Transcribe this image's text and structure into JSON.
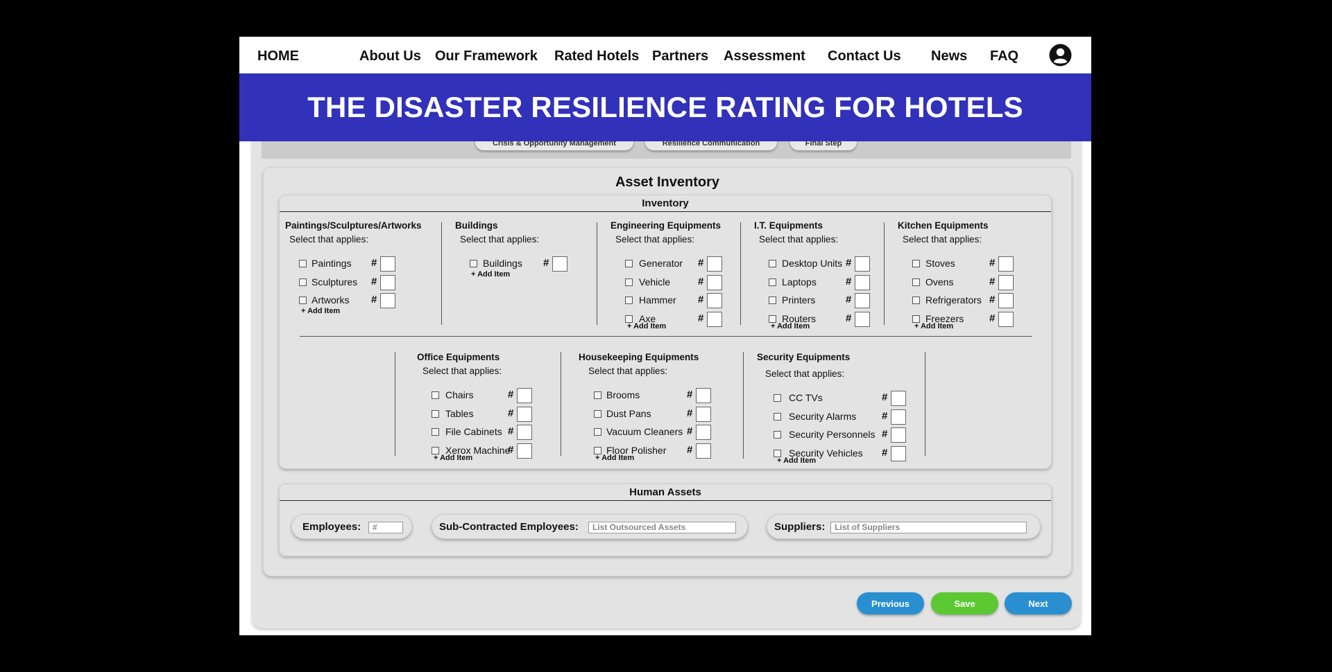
{
  "nav": {
    "home": "HOME",
    "items": [
      "About Us",
      "Our Framework",
      "Rated Hotels",
      "Partners",
      "Assessment",
      "Contact Us",
      "News",
      "FAQ"
    ]
  },
  "banner": {
    "title": "THE DISASTER RESILIENCE RATING FOR HOTELS"
  },
  "steps": [
    "Crisis & Opportunity Management",
    "Resilience Communication",
    "Final Step"
  ],
  "asset_inventory": {
    "title": "Asset Inventory",
    "inventory": {
      "title": "Inventory",
      "hash": "#",
      "add_item": "+ Add Item",
      "select_prompt": "Select that applies:",
      "groups": [
        {
          "title": "Paintings/Sculptures/Artworks",
          "items": [
            "Paintings",
            "Sculptures",
            "Artworks"
          ]
        },
        {
          "title": "Buildings",
          "items": [
            "Buildings"
          ]
        },
        {
          "title": "Engineering Equipments",
          "items": [
            "Generator",
            "Vehicle",
            "Hammer",
            "Axe"
          ]
        },
        {
          "title": "I.T. Equipments",
          "items": [
            "Desktop Units",
            "Laptops",
            "Printers",
            "Routers"
          ]
        },
        {
          "title": "Kitchen Equipments",
          "items": [
            "Stoves",
            "Ovens",
            "Refrigerators",
            "Freezers"
          ]
        },
        {
          "title": "Office Equipments",
          "items": [
            "Chairs",
            "Tables",
            "File Cabinets",
            "Xerox Machine"
          ]
        },
        {
          "title": "Housekeeping Equipments",
          "items": [
            "Brooms",
            "Dust Pans",
            "Vacuum Cleaners",
            "Floor Polisher"
          ]
        },
        {
          "title": "Security Equipments",
          "items": [
            "CC TVs",
            "Security Alarms",
            "Security Personnels",
            "Security Vehicles"
          ]
        }
      ]
    },
    "human_assets": {
      "title": "Human Assets",
      "employees_label": "Employees:",
      "employees_placeholder": "#",
      "subcontracted_label": "Sub-Contracted Employees:",
      "subcontracted_placeholder": "List Outsourced Assets",
      "suppliers_label": "Suppliers:",
      "suppliers_placeholder": "List of Suppliers"
    }
  },
  "buttons": {
    "previous": "Previous",
    "save": "Save",
    "next": "Next"
  },
  "colors": {
    "banner": "#3131b9",
    "previous": "#2a8fd0",
    "save": "#5cc832",
    "next": "#2a8fd0"
  }
}
